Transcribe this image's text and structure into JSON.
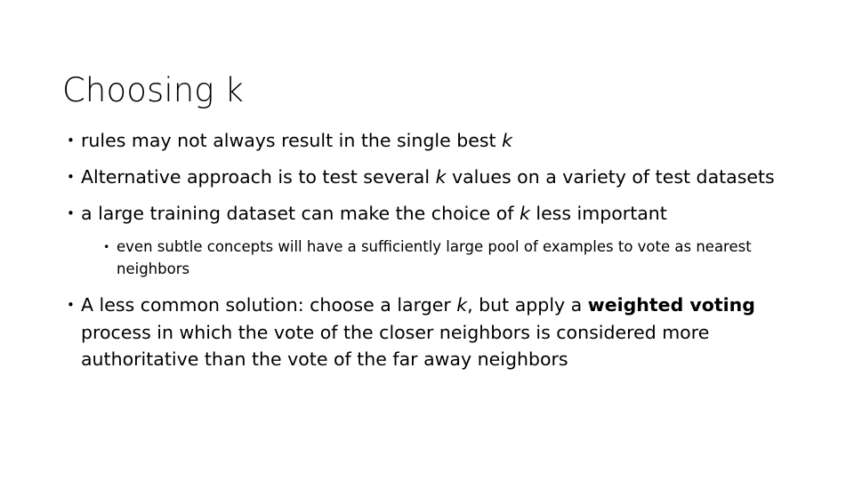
{
  "slide": {
    "title": "Choosing k",
    "background_color": "#ffffff",
    "text_color": "#000000",
    "bullet_marker": "•",
    "bullets": [
      {
        "level": 1,
        "marker": "•",
        "text_plain": "rules may not always result in the single best k",
        "segments": [
          {
            "text": "rules may not always result in the single best ",
            "style": "normal"
          },
          {
            "text": "k",
            "style": "italic"
          }
        ]
      },
      {
        "level": 1,
        "marker": "•",
        "text_plain": "Alternative approach is to test several k values on a variety of test datasets",
        "segments": [
          {
            "text": "Alternative approach is to test several ",
            "style": "normal"
          },
          {
            "text": "k",
            "style": "italic"
          },
          {
            "text": " values on a variety of test datasets",
            "style": "normal"
          }
        ]
      },
      {
        "level": 1,
        "marker": "•",
        "text_plain": "a large training dataset can make the choice of k less important",
        "segments": [
          {
            "text": "a large training dataset can make the choice of ",
            "style": "normal"
          },
          {
            "text": "k",
            "style": "italic"
          },
          {
            "text": " less important",
            "style": "normal"
          }
        ]
      },
      {
        "level": 2,
        "marker": "•",
        "text_plain": "even subtle concepts will have a sufficiently large pool of examples to vote as nearest neighbors",
        "segments": [
          {
            "text": "even subtle concepts will have a sufficiently large pool of examples to vote as nearest neighbors",
            "style": "normal"
          }
        ]
      },
      {
        "level": 1,
        "marker": "•",
        "text_plain": "A less common solution: choose a larger k, but apply a weighted voting process in which the vote of the closer neighbors is considered more authoritative than the vote of the far away neighbors",
        "segments": [
          {
            "text": "A less common solution: choose a larger ",
            "style": "normal"
          },
          {
            "text": "k",
            "style": "italic"
          },
          {
            "text": ", but apply a ",
            "style": "normal"
          },
          {
            "text": "weighted voting",
            "style": "bold"
          },
          {
            "text": " process in which the vote of the closer neighbors is considered more authoritative than the vote of the far away neighbors",
            "style": "normal"
          }
        ]
      }
    ]
  }
}
